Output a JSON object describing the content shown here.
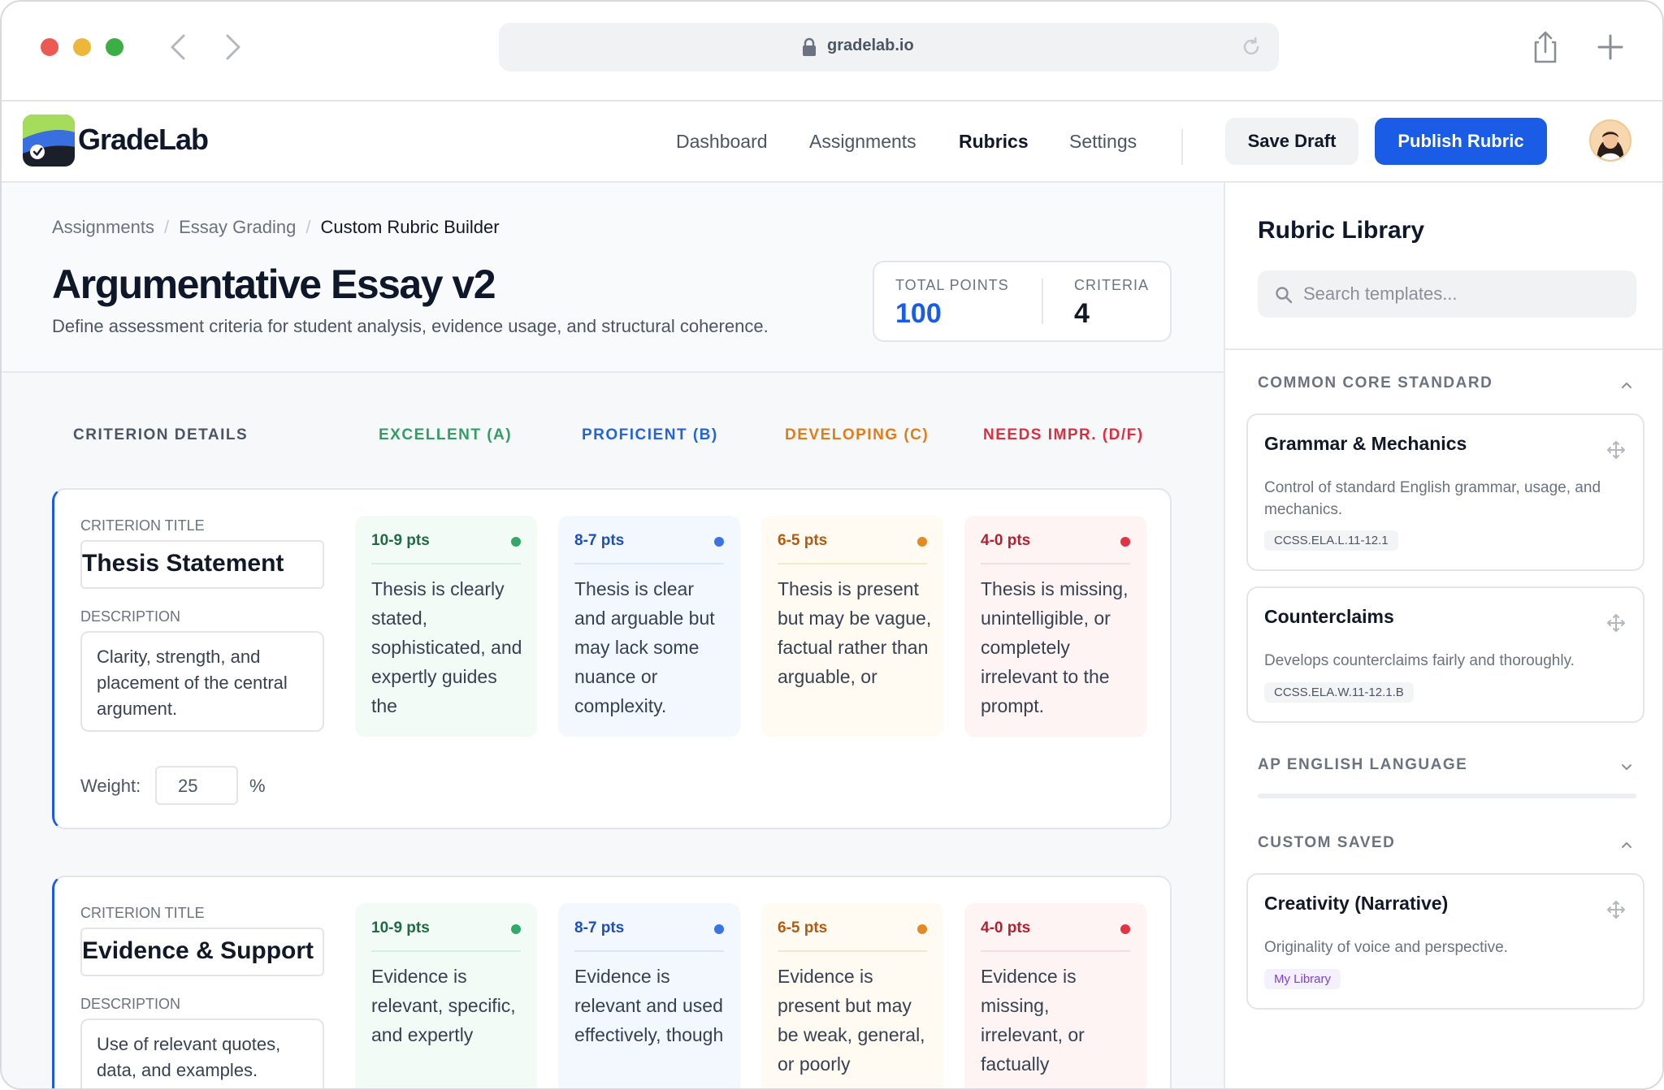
{
  "browser": {
    "url": "gradelab.io"
  },
  "app": {
    "name": "GradeLab",
    "nav": [
      "Dashboard",
      "Assignments",
      "Rubrics",
      "Settings"
    ],
    "active_nav": "Rubrics",
    "save_label": "Save Draft",
    "publish_label": "Publish Rubric"
  },
  "page": {
    "breadcrumb": [
      "Assignments",
      "Essay Grading",
      "Custom Rubric Builder"
    ],
    "title": "Argumentative Essay v2",
    "subtitle": "Define assessment criteria for student analysis, evidence usage, and structural coherence.",
    "stats": {
      "total_points_label": "TOTAL POINTS",
      "total_points": "100",
      "criteria_label": "CRITERIA",
      "criteria": "4"
    }
  },
  "columns": {
    "details": "CRITERION DETAILS",
    "levels": [
      {
        "label": "EXCELLENT (A)",
        "color": "#2f9e63"
      },
      {
        "label": "PROFICIENT (B)",
        "color": "#2563d8"
      },
      {
        "label": "DEVELOPING (C)",
        "color": "#df7d1b"
      },
      {
        "label": "NEEDS IMPR. (D/F)",
        "color": "#db2f3f"
      }
    ]
  },
  "criteria": [
    {
      "title_label": "CRITERION TITLE",
      "title": "Thesis Statement",
      "desc_label": "DESCRIPTION",
      "description": "Clarity, strength, and placement of the central argument.",
      "weight_label": "Weight:",
      "weight": "25",
      "weight_unit": "%",
      "levels": [
        {
          "pts": "10-9 pts",
          "text": "Thesis is clearly stated, sophisticated, and expertly guides the"
        },
        {
          "pts": "8-7 pts",
          "text": "Thesis is clear and arguable but may lack some nuance or complexity."
        },
        {
          "pts": "6-5 pts",
          "text": "Thesis is present but may be vague, factual rather than arguable, or"
        },
        {
          "pts": "4-0 pts",
          "text": "Thesis is missing, unintelligible, or completely irrelevant to the prompt."
        }
      ]
    },
    {
      "title_label": "CRITERION TITLE",
      "title": "Evidence & Support",
      "desc_label": "DESCRIPTION",
      "description": "Use of relevant quotes, data, and examples.",
      "levels": [
        {
          "pts": "10-9 pts",
          "text": "Evidence is relevant, specific, and expertly"
        },
        {
          "pts": "8-7 pts",
          "text": "Evidence is relevant and used effectively, though"
        },
        {
          "pts": "6-5 pts",
          "text": "Evidence is present but may be weak, general, or poorly"
        },
        {
          "pts": "4-0 pts",
          "text": "Evidence is missing, irrelevant, or factually"
        }
      ]
    }
  ],
  "sidebar": {
    "title": "Rubric Library",
    "search_placeholder": "Search templates...",
    "sections": {
      "common_core": "COMMON CORE STANDARD",
      "ap_english": "AP ENGLISH LANGUAGE",
      "custom": "CUSTOM SAVED"
    },
    "templates": [
      {
        "name": "Grammar & Mechanics",
        "desc": "Control of standard English grammar, usage, and mechanics.",
        "tag": "CCSS.ELA.L.11-12.1"
      },
      {
        "name": "Counterclaims",
        "desc": "Develops counterclaims fairly and thoroughly.",
        "tag": "CCSS.ELA.W.11-12.1.B"
      },
      {
        "name": "Creativity (Narrative)",
        "desc": "Originality of voice and perspective.",
        "tag": "My Library"
      }
    ]
  }
}
